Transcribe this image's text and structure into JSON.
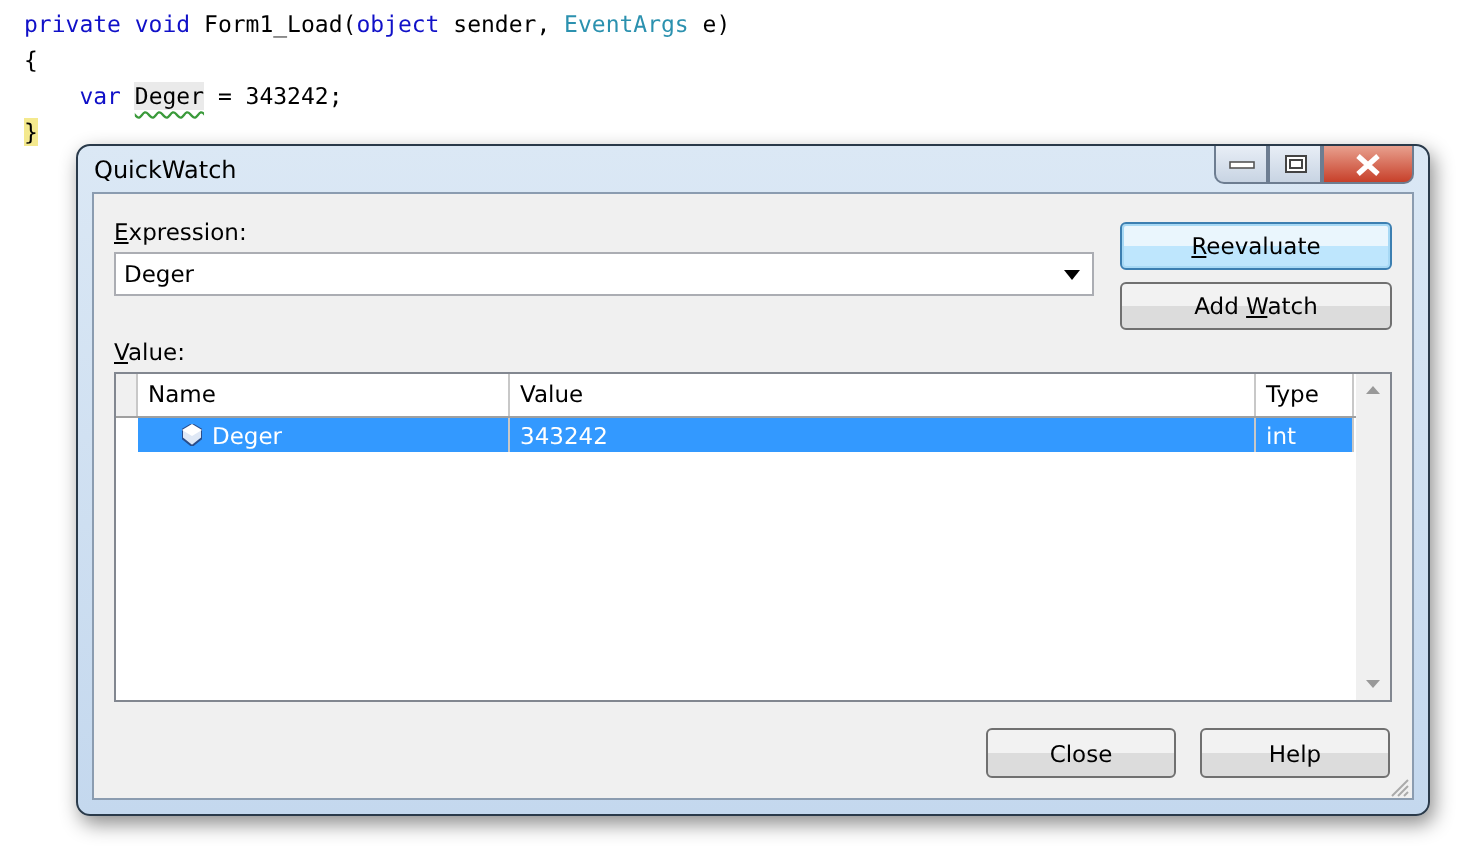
{
  "editor": {
    "lines": [
      {
        "tokens": [
          {
            "text": "private void",
            "kind": "keyword"
          },
          {
            "text": " Form1_Load(",
            "kind": "plain"
          },
          {
            "text": "object",
            "kind": "keyword"
          },
          {
            "text": " sender, ",
            "kind": "plain"
          },
          {
            "text": "EventArgs",
            "kind": "type"
          },
          {
            "text": " e)",
            "kind": "plain"
          }
        ]
      },
      {
        "tokens": [
          {
            "text": "{",
            "kind": "plain"
          }
        ]
      },
      {
        "tokens": [
          {
            "text": "    var ",
            "kind": "keyword"
          },
          {
            "text": "Deger",
            "kind": "squiggle"
          },
          {
            "text": " = 343242;",
            "kind": "plain"
          }
        ]
      },
      {
        "tokens": [
          {
            "text": "}",
            "kind": "highlight"
          }
        ]
      }
    ]
  },
  "dialog": {
    "title": "QuickWatch",
    "expression": {
      "label": {
        "key": "E",
        "after": "xpression:"
      },
      "value": "Deger"
    },
    "side_buttons": [
      {
        "key": "R",
        "after": "eevaluate",
        "focused": true
      },
      {
        "before": "Add ",
        "key": "W",
        "after": "atch",
        "focused": false
      }
    ],
    "value_label": {
      "key": "V",
      "after": "alue:"
    },
    "table": {
      "columns": [
        "Name",
        "Value",
        "Type"
      ],
      "rows": [
        {
          "name": "Deger",
          "value": "343242",
          "type": "int",
          "selected": true
        }
      ]
    },
    "buttons": [
      {
        "label": "Close",
        "focused": false
      },
      {
        "label": "Help",
        "focused": false
      }
    ]
  }
}
